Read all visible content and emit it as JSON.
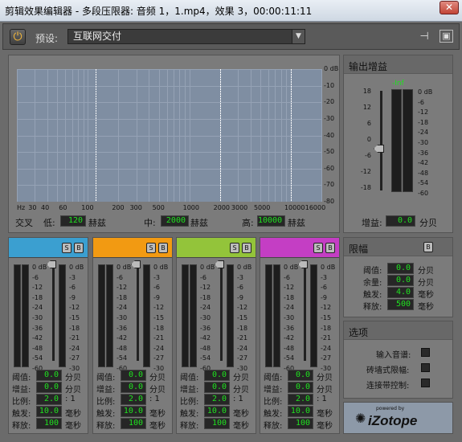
{
  "window": {
    "title": "剪辑效果编辑器 - 多段压限器: 音频 1，1.mp4，效果 3，00:00:11:11",
    "close": "✕"
  },
  "toolbar": {
    "preset_label": "预设:",
    "preset_value": "互联网交付"
  },
  "graph": {
    "db_labels": [
      "0 dB",
      "-10",
      "-20",
      "-30",
      "-40",
      "-50",
      "-60",
      "-70",
      "-80"
    ],
    "freq_labels": [
      "Hz",
      "30",
      "40",
      "60",
      "100",
      "200",
      "300",
      "500",
      "1000",
      "2000",
      "3000",
      "5000",
      "10000",
      "16000"
    ]
  },
  "crossover": {
    "label": "交叉",
    "low_label": "低:",
    "low_value": "120",
    "low_unit": "赫兹",
    "mid_label": "中:",
    "mid_value": "2000",
    "mid_unit": "赫兹",
    "high_label": "高:",
    "high_value": "10000",
    "high_unit": "赫兹"
  },
  "output": {
    "title": "输出增益",
    "inf": "-Inf",
    "fader_scale": [
      "18",
      "12",
      "6",
      "0",
      "-6",
      "-12",
      "-18"
    ],
    "meter_scale": [
      "0 dB",
      "-6",
      "-12",
      "-18",
      "-24",
      "-30",
      "-36",
      "-42",
      "-48",
      "-54",
      "-60"
    ],
    "gain_label": "增益:",
    "gain_value": "0.0",
    "gain_unit": "分贝"
  },
  "bands": [
    {
      "color": "#3b9fd0",
      "s": "S",
      "b": "B"
    },
    {
      "color": "#f29a12",
      "s": "S",
      "b": "B"
    },
    {
      "color": "#93c43a",
      "s": "S",
      "b": "B"
    },
    {
      "color": "#c43ec4",
      "s": "S",
      "b": "B"
    }
  ],
  "band_scale_left": [
    "0 dB",
    "-6",
    "-12",
    "-18",
    "-24",
    "-30",
    "-36",
    "-42",
    "-48",
    "-54",
    "-60"
  ],
  "band_scale_right": [
    "0 dB",
    "-3",
    "-6",
    "-9",
    "-12",
    "-15",
    "-18",
    "-21",
    "-24",
    "-27",
    "-30"
  ],
  "band_params": {
    "threshold_label": "阈值:",
    "threshold_value": "0.0",
    "threshold_unit": "分贝",
    "gain_label": "增益:",
    "gain_value": "0.0",
    "gain_unit": "分贝",
    "ratio_label": "比例:",
    "ratio_value": "2.0",
    "ratio_unit": ": 1",
    "attack_label": "触发:",
    "attack_value": "10.0",
    "attack_unit": "毫秒",
    "release_label": "释放:",
    "release_value": "100",
    "release_unit": "毫秒"
  },
  "limiter": {
    "title": "限幅",
    "b": "B",
    "threshold_label": "阈值:",
    "threshold_value": "0.0",
    "threshold_unit": "分贝",
    "margin_label": "余量:",
    "margin_value": "0.0",
    "margin_unit": "分贝",
    "attack_label": "触发:",
    "attack_value": "4.0",
    "attack_unit": "毫秒",
    "release_label": "释放:",
    "release_value": "500",
    "release_unit": "毫秒"
  },
  "options": {
    "title": "选项",
    "input_spectrum": "输入音谱:",
    "brickwall": "砖墙式限幅:",
    "band_control": "连接带控制:"
  },
  "logo": {
    "powered": "powered by",
    "name": "iZotope",
    "mark": "✺"
  }
}
